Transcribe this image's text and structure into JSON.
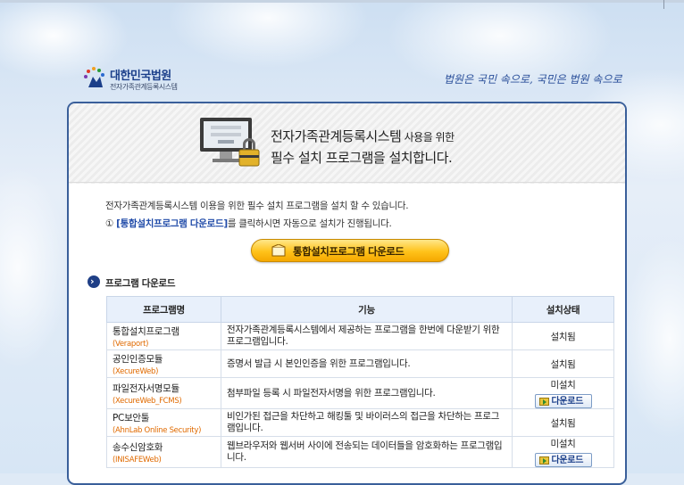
{
  "header": {
    "logo_title": "대한민국법원",
    "logo_subtitle": "전자가족관계등록시스템",
    "slogan": "법원은 국민 속으로, 국민은 법원 속으로"
  },
  "hero": {
    "title_main": "전자가족관계등록시스템",
    "title_suffix": " 사용을 위한",
    "title_line2": "필수 설치 프로그램을 설치합니다."
  },
  "intro": {
    "line1": "전자가족관계등록시스템 이용을 위한 필수 설치 프로그램을 설치 할 수 있습니다.",
    "line2_prefix": "① ",
    "line2_link": "[통합설치프로그램 다운로드]",
    "line2_suffix": "를 클릭하시면 자동으로 설치가 진행됩니다."
  },
  "big_button": {
    "label": "통합설치프로그램 다운로드"
  },
  "section": {
    "title": "프로그램 다운로드"
  },
  "table": {
    "headers": [
      "프로그램명",
      "기능",
      "설치상태"
    ],
    "rows": [
      {
        "name": "통합설치프로그램",
        "vendor": "(Veraport)",
        "desc": "전자가족관계등록시스템에서 제공하는 프로그램을 한번에 다운받기 위한 프로그램입니다.",
        "status": "설치됨",
        "button": ""
      },
      {
        "name": "공인인증모듈",
        "vendor": "(XecureWeb)",
        "desc": "증명서 발급 시 본인인증을 위한 프로그램입니다.",
        "status": "설치됨",
        "button": ""
      },
      {
        "name": "파일전자서명모듈",
        "vendor": "(XecureWeb_FCMS)",
        "desc": "첨부파일 등록 시 파일전자서명을 위한 프로그램입니다.",
        "status": "미설치",
        "button": "다운로드"
      },
      {
        "name": "PC보안툴",
        "vendor": "(AhnLab Online Security)",
        "desc": "비인가된 접근을 차단하고 해킹툴 및 바이러스의 접근을 차단하는 프로그램입니다.",
        "status": "설치됨",
        "button": ""
      },
      {
        "name": "송수신암호화",
        "vendor": "(INISAFEWeb)",
        "desc": "웹브라우저와 웹서버 사이에 전송되는 데이터들을 암호화하는 프로그램입니다.",
        "status": "미설치",
        "button": "다운로드"
      }
    ]
  },
  "colors": {
    "panel_border": "#3a5f9a",
    "accent_orange": "#e06a00",
    "button_gold": "#ffc21a",
    "link_blue": "#1f4aa8"
  }
}
